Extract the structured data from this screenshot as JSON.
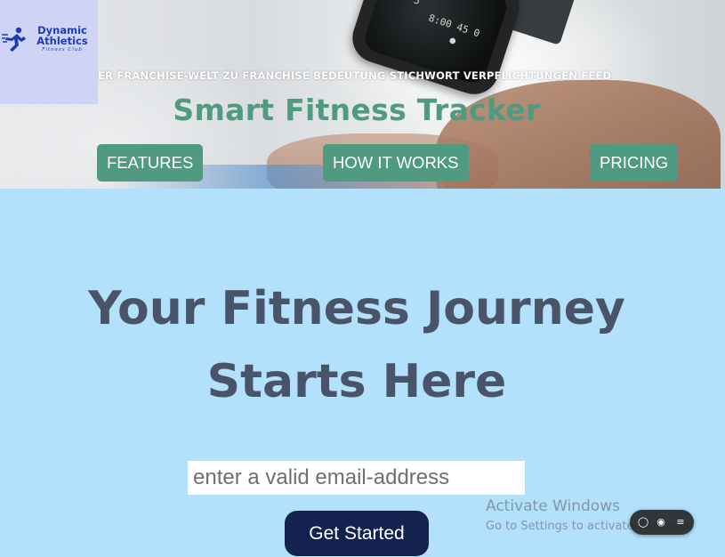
{
  "header": {
    "banner_text": "ER FRANCHISE-WELT ZU FRANCHISE BEDEUTUNG STICHWORT VERPFLICHTUNGEN FEED",
    "title": "Smart Fitness Tracker",
    "logo": {
      "line1": "Dynamic",
      "line2": "Athletics",
      "sub": "Fitness Club",
      "icon": "runner-icon",
      "color": "#1c3bb5",
      "bg": "#cfd4f6"
    },
    "nav": [
      {
        "label": "FEATURES"
      },
      {
        "label": "HOW IT WORKS"
      },
      {
        "label": "PRICING"
      }
    ],
    "accent_color": "#4f9a80"
  },
  "hero": {
    "heading_line1": "Your Fitness Journey",
    "heading_line2": "Starts Here",
    "email_placeholder": "enter a valid email-address",
    "email_value": "",
    "cta_label": "Get Started",
    "bg_color": "#b3e0fb",
    "cta_color": "#14224f"
  },
  "watermark": {
    "title": "Activate Windows",
    "subtitle": "Go to Settings to activate Windows."
  },
  "floating_toolbar": {
    "icons": [
      "chat-icon",
      "record-icon",
      "menu-icon"
    ]
  }
}
